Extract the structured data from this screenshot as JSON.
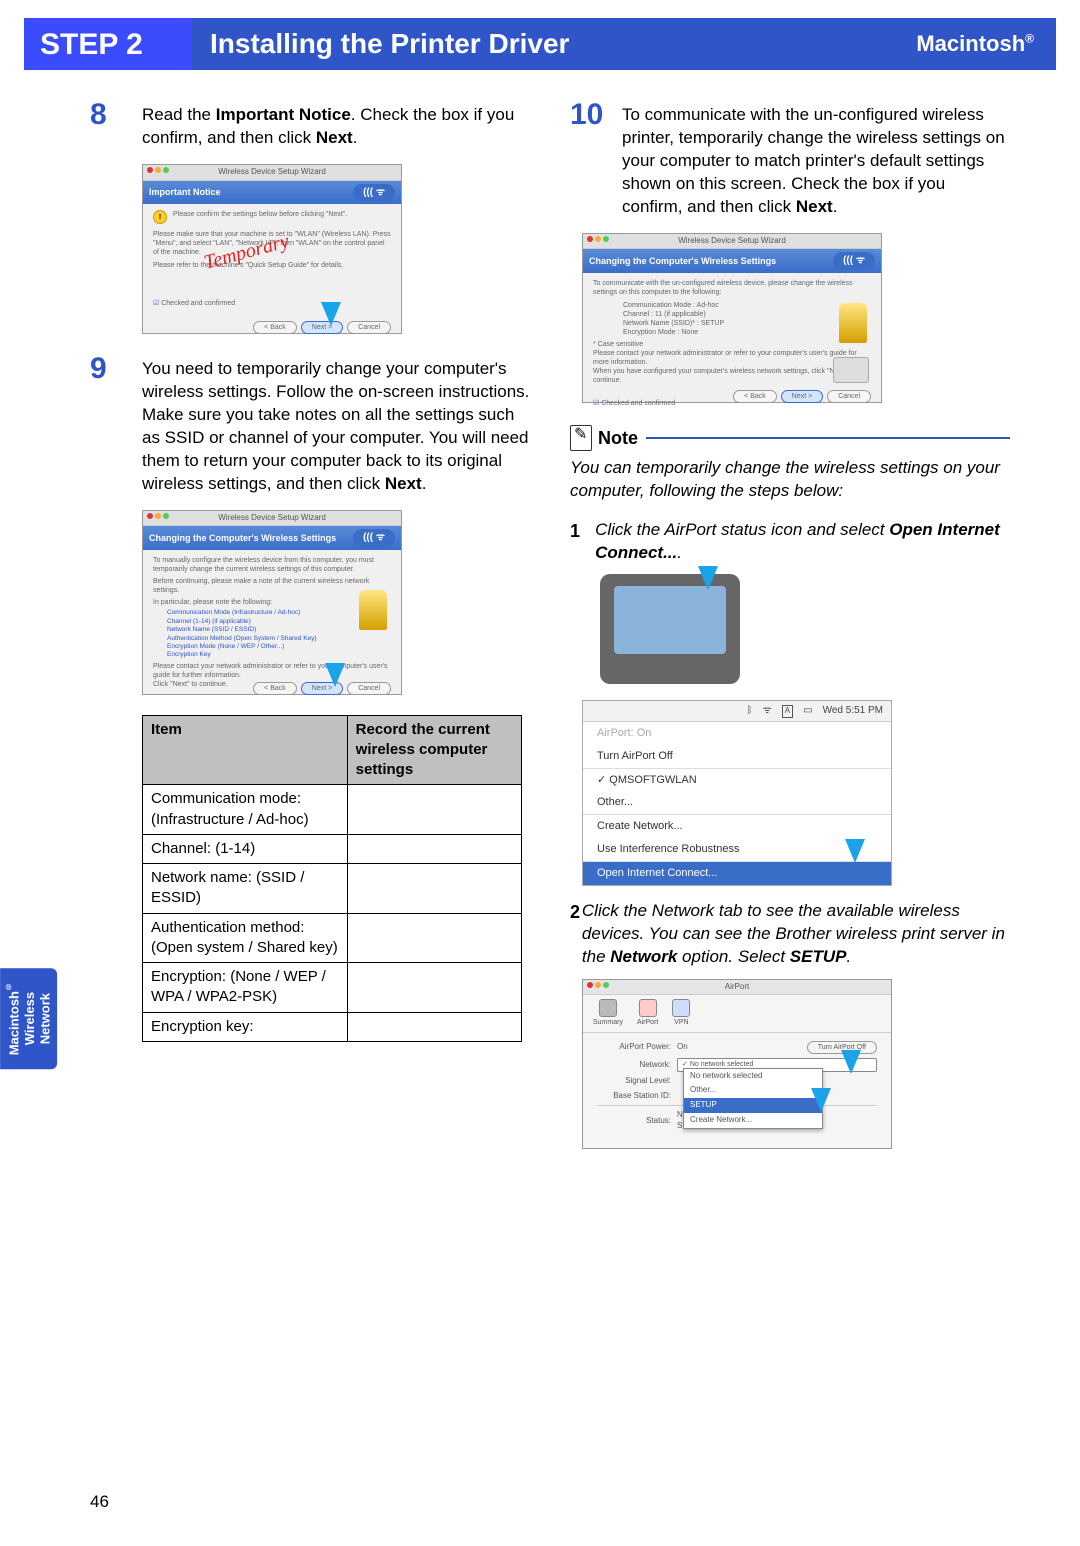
{
  "header": {
    "step_label": "STEP",
    "step_num": "2",
    "title": "Installing the Printer Driver",
    "platform": "Macintosh",
    "platform_sup": "®"
  },
  "col1": {
    "step8": {
      "num": "8",
      "text_before_bold1": "Read the ",
      "bold1": "Important Notice",
      "text_mid": ". Check the box if you confirm, and then click ",
      "bold2": "Next",
      "text_after": "."
    },
    "shot8": {
      "wizard_title": "Wireless Device Setup Wizard",
      "heading": "Important Notice",
      "line1": "Please confirm the settings below before clicking \"Next\".",
      "line2": "Please make sure that your machine is set to \"WLAN\" (Wireless LAN). Press \"Menu\", and select \"LAN\", \"Network I/F\", then \"WLAN\" on the control panel of the machine.",
      "line3": "Please refer to the machine's \"Quick Setup Guide\" for details.",
      "checkbox": "Checked and confirmed",
      "back": "< Back",
      "next": "Next >",
      "cancel": "Cancel",
      "stamp": "Temporary"
    },
    "step9": {
      "num": "9",
      "text": "You need to temporarily change your computer's wireless settings. Follow the on-screen instructions. Make sure you take notes on all the settings such as SSID or channel of your computer. You will need them to return your computer back to its original wireless settings, and then click ",
      "bold": "Next",
      "after": "."
    },
    "shot9": {
      "wizard_title": "Wireless Device Setup Wizard",
      "heading": "Changing the Computer's Wireless Settings",
      "line1": "To manually configure the wireless device from this computer, you must temporarily change the current wireless settings of this computer.",
      "line2": "Before continuing, please make a note of the current wireless network settings.",
      "line3": "In particular, please note the following:",
      "bullets": {
        "b1": "Communication Mode (Infrastructure / Ad-hoc)",
        "b2": "Channel (1-14) (if applicable)",
        "b3": "Network Name (SSID / ESSID)",
        "b4": "Authentication Method (Open System / Shared Key)",
        "b5": "Encryption Mode (None / WEP / Other...)",
        "b6": "Encryption Key"
      },
      "line4": "Please contact your network administrator or refer to your computer's user's guide for further information.",
      "line5": "Click \"Next\" to continue.",
      "back": "< Back",
      "next": "Next >",
      "cancel": "Cancel"
    },
    "table": {
      "h1": "Item",
      "h2": "Record the current wireless computer settings",
      "rows": [
        "Communication mode: (Infrastructure / Ad-hoc)",
        "Channel: (1-14)",
        "Network name: (SSID / ESSID)",
        "Authentication method: (Open system / Shared key)",
        "Encryption: (None / WEP / WPA / WPA2-PSK)",
        "Encryption key:"
      ]
    }
  },
  "col2": {
    "step10": {
      "num": "10",
      "text": "To communicate with the un-configured wireless printer, temporarily change the wireless settings on your computer to match printer's default settings shown on this screen. Check the box if you confirm, and then click ",
      "bold": "Next",
      "after": "."
    },
    "shot10": {
      "wizard_title": "Wireless Device Setup Wizard",
      "heading": "Changing the Computer's Wireless Settings",
      "line1": "To communicate with the un-configured wireless device, please change the wireless settings on this computer to the following:",
      "s1l": "Communication Mode :",
      "s1v": "Ad-hoc",
      "s2l": "Channel :",
      "s2v": "11  (if applicable)",
      "s3l": "Network Name (SSID)* :",
      "s3v": "SETUP",
      "s4l": "Encryption Mode :",
      "s4v": "None",
      "case": "* Case sensitive",
      "line2": "Please contact your network administrator or refer to your computer's user's guide for more information.",
      "line3": "When you have configured your computer's wireless network settings, click \"Next\" to continue.",
      "checkbox": "Checked and confirmed",
      "back": "< Back",
      "next": "Next >",
      "cancel": "Cancel"
    },
    "note": {
      "label": "Note",
      "body": "You can temporarily change the wireless settings on your computer, following the steps below:"
    },
    "sub1": {
      "num": "1",
      "text": "Click the AirPort status icon and select ",
      "bold": "Open Internet Connect...",
      "after": "."
    },
    "menubar": {
      "time": "Wed 5:51 PM",
      "items": {
        "i0": "AirPort: On",
        "i1": "Turn AirPort Off",
        "i2": "QMSOFTGWLAN",
        "i3": "Other...",
        "i4": "Create Network...",
        "i5": "Use Interference Robustness",
        "i6": "Open Internet Connect..."
      }
    },
    "sub2": {
      "num": "2",
      "text1": "Click the Network tab to see the available wireless devices. You can see the Brother wireless print server in the ",
      "bold1": "Network",
      "text2": " option. Select ",
      "bold2": "SETUP",
      "after": "."
    },
    "airport": {
      "title": "AirPort",
      "tabs": {
        "t1": "Summary",
        "t2": "AirPort",
        "t3": "VPN"
      },
      "power_label": "AirPort Power:",
      "power_val": "On",
      "power_btn": "Turn AirPort Off",
      "net_label": "Network:",
      "net_val": "No network selected",
      "dd": {
        "d1": "No network selected",
        "d2": "Other...",
        "d3": "SETUP",
        "d4": "Create Network..."
      },
      "sig_label": "Signal Level:",
      "base_label": "Base Station ID:",
      "status_label": "Status:",
      "status_val": "Not associated with any network\nStatus not available"
    }
  },
  "side_tab": {
    "l1": "Macintosh",
    "sup": "®",
    "l2": "Wireless",
    "l3": "Network"
  },
  "page_number": "46"
}
